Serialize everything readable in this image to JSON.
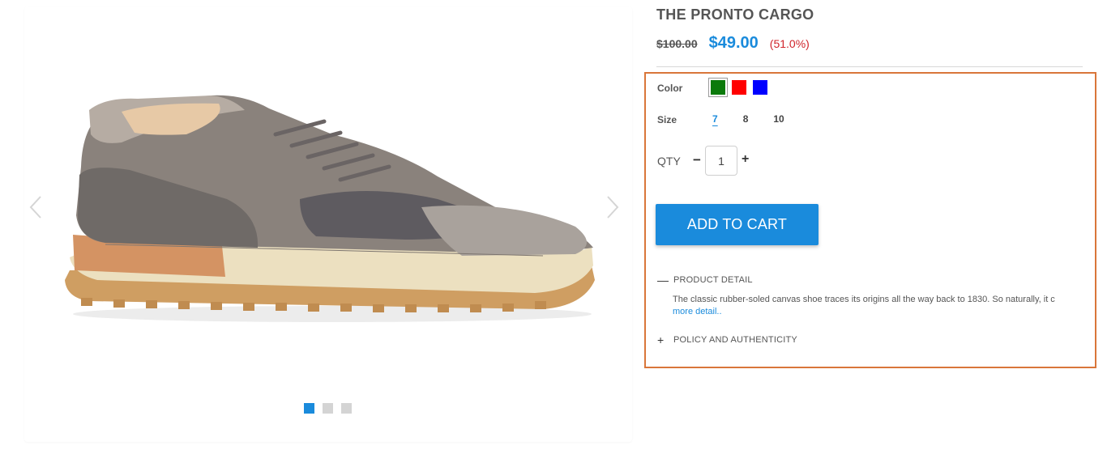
{
  "gallery": {
    "prev_icon": "chevron-left-icon",
    "next_icon": "chevron-right-icon",
    "image_alt": "Grey suede sneaker with tan rubber sole",
    "slides": [
      {
        "active": true
      },
      {
        "active": false
      },
      {
        "active": false
      }
    ]
  },
  "product": {
    "title": "THE PRONTO CARGO",
    "old_price": "$100.00",
    "new_price": "$49.00",
    "discount": "(51.0%)"
  },
  "options": {
    "color_label": "Color",
    "colors": [
      {
        "hex": "#0b7a0b",
        "selected": true
      },
      {
        "hex": "#ff0000",
        "selected": false
      },
      {
        "hex": "#0000ff",
        "selected": false
      }
    ],
    "size_label": "Size",
    "sizes": [
      {
        "label": "7",
        "selected": true
      },
      {
        "label": "8",
        "selected": false
      },
      {
        "label": "10",
        "selected": false
      }
    ],
    "qty_label": "QTY",
    "qty_minus": "−",
    "qty_value": "1",
    "qty_plus": "+"
  },
  "cart": {
    "add_label": "ADD TO CART"
  },
  "accordion": {
    "detail_icon": "—",
    "detail_title": "PRODUCT DETAIL",
    "detail_text": "The classic rubber-soled canvas shoe traces its origins all the way back to 1830. So naturally, it c",
    "more_link": "more detail..",
    "policy_icon": "+",
    "policy_title": "POLICY AND AUTHENTICITY"
  },
  "colors": {
    "accent": "#1a8bdc",
    "discount": "#d0242b",
    "highlight_border": "#d9763a"
  }
}
